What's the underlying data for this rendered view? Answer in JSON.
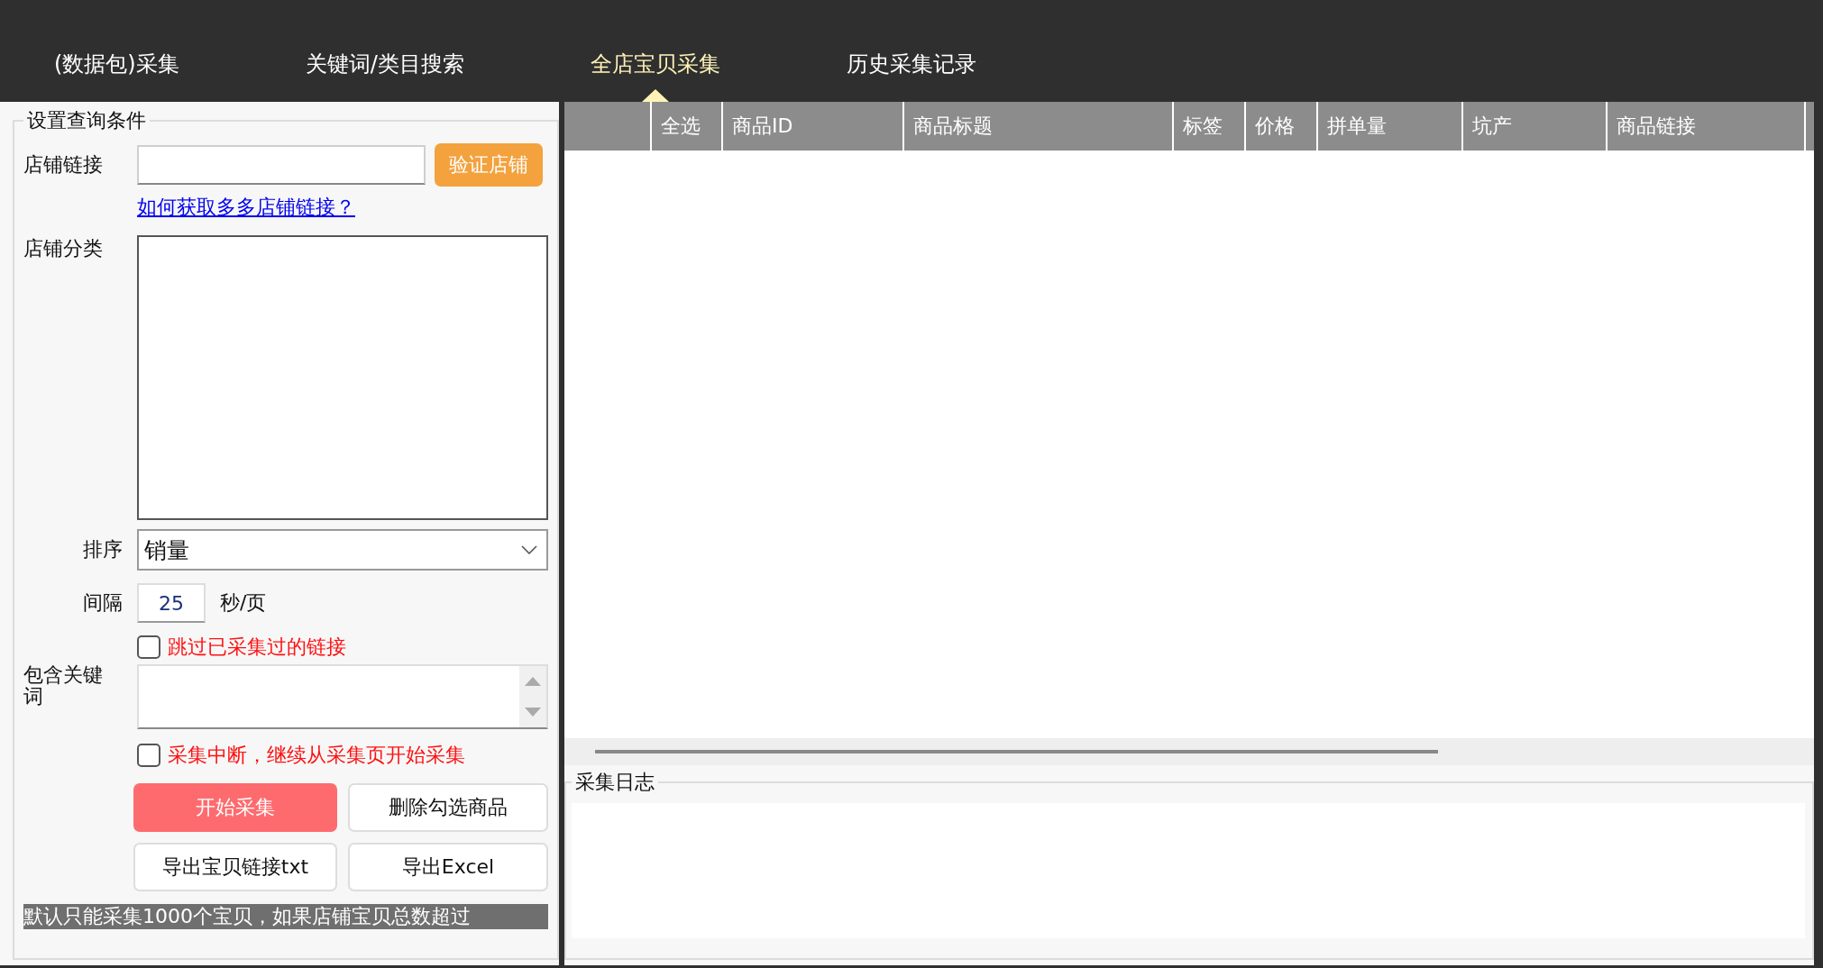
{
  "nav": {
    "tabs": [
      {
        "label": "(数据包)采集",
        "selected": false
      },
      {
        "label": "关键词/类目搜索",
        "selected": false
      },
      {
        "label": "全店宝贝采集",
        "selected": true
      },
      {
        "label": "历史采集记录",
        "selected": false
      }
    ]
  },
  "query_panel": {
    "title": "设置查询条件",
    "shop_link": {
      "label": "店铺链接"
    },
    "verify_button": "验证店铺",
    "help_link": "如何获取多多店铺链接？",
    "category": {
      "label": "店铺分类"
    },
    "sort": {
      "label": "排序",
      "value": "销量"
    },
    "interval": {
      "label": "间隔",
      "value": "25",
      "unit": "秒/页"
    },
    "skip_checkbox": {
      "label": "跳过已采集过的链接",
      "checked": false
    },
    "keywords": {
      "label": "包含关键词"
    },
    "resume_checkbox": {
      "label": "采集中断，继续从采集页开始采集",
      "checked": false
    },
    "buttons": [
      {
        "label": "开始采集",
        "kind": "primary"
      },
      {
        "label": "删除勾选商品",
        "kind": "default"
      },
      {
        "label": "导出宝贝链接txt",
        "kind": "default"
      },
      {
        "label": "导出Excel",
        "kind": "default"
      }
    ],
    "notice": "默认只能采集1000个宝贝，如果店铺宝贝总数超过"
  },
  "table": {
    "columns": [
      "全选",
      "商品ID",
      "商品标题",
      "标签",
      "价格",
      "拼单量",
      "坑产",
      "商品链接"
    ]
  },
  "log": {
    "title": "采集日志"
  }
}
